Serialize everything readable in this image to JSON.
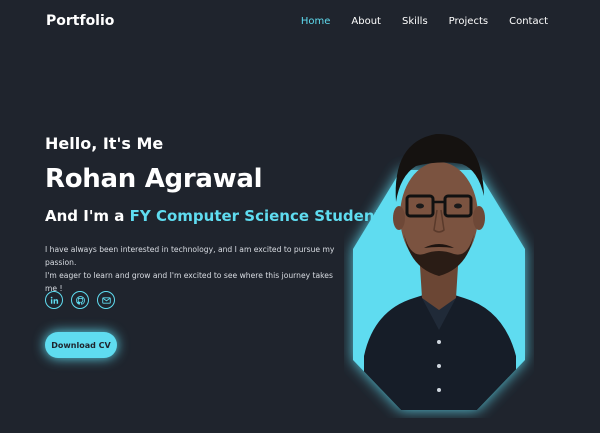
{
  "header": {
    "logo": "Portfolio",
    "nav": [
      "Home",
      "About",
      "Skills",
      "Projects",
      "Contact"
    ],
    "active": "Home"
  },
  "hero": {
    "greeting": "Hello, It's Me",
    "name": "Rohan Agrawal",
    "role_prefix": "And I'm a ",
    "role_highlight": "FY Computer Science Student",
    "description_line1": "I have always been interested in technology, and I am excited to pursue my passion.",
    "description_line2": "I'm eager to learn and grow and I'm excited to see where this journey takes me !",
    "socials": [
      "linkedin-icon",
      "github-icon",
      "mail-icon"
    ],
    "cv_button": "Download CV"
  },
  "colors": {
    "background": "#1f242d",
    "accent": "#5fdcf0",
    "text": "#ffffff"
  }
}
